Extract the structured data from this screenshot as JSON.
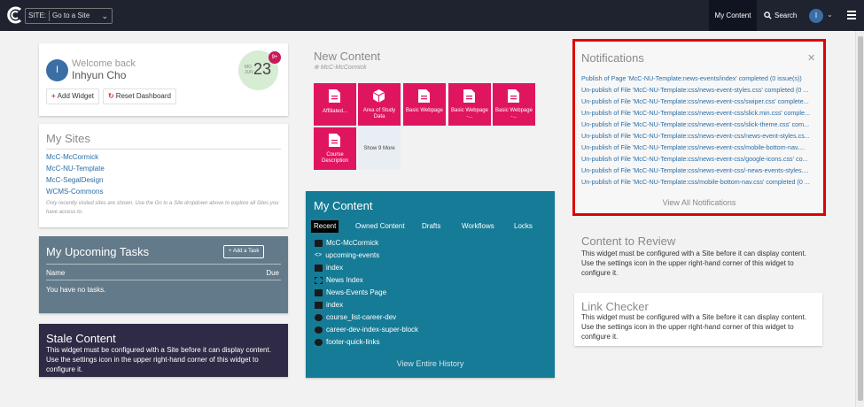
{
  "topbar": {
    "site_label": "SITE:",
    "site_select": "Go to a Site",
    "nav_my_content": "My Content",
    "nav_search": "Search",
    "user_initial": "I"
  },
  "welcome": {
    "avatar_initial": "I",
    "greeting": "Welcome back",
    "user_name": "Inhyun Cho",
    "date_month_top": "MO",
    "date_month": "JUN",
    "date_day": "23",
    "badge_count": "9+",
    "add_widget": "Add Widget",
    "reset_dashboard": "Reset Dashboard"
  },
  "my_sites": {
    "title": "My Sites",
    "sites": [
      "McC-McCormick",
      "McC-NU-Template",
      "McC-SegalDesign",
      "WCMS-Commons"
    ],
    "note": "Only recently visited sites are shown. Use the Go to a Site dropdown above to explore all Sites you have access to."
  },
  "tasks": {
    "title": "My Upcoming Tasks",
    "add_task": "Add a Task",
    "col_name": "Name",
    "col_due": "Due",
    "empty": "You have no tasks."
  },
  "stale": {
    "title": "Stale Content",
    "message": "This widget must be configured with a Site before it can display content. Use the settings icon in the upper right-hand corner of this widget to configure it."
  },
  "new_content": {
    "title": "New Content",
    "site": "McC-McCormick",
    "tiles": [
      "Affiliated...",
      "Area of Study Data",
      "Basic Webpage",
      "Basic Webpage -...",
      "Basic Webpage -...",
      "Course Description"
    ],
    "show_more": "Show 9 More"
  },
  "my_content": {
    "title": "My Content",
    "tabs": [
      "Recent",
      "Owned Content",
      "Drafts",
      "Workflows",
      "Locks"
    ],
    "items": [
      "McC-McCormick",
      "upcoming-events",
      "index",
      "News Index",
      "News-Events Page",
      "index",
      "course_list-career-dev",
      "career-dev-index-super-block",
      "footer-quick-links"
    ],
    "view_history": "View Entire History"
  },
  "notifications": {
    "title": "Notifications",
    "items": [
      "Publish of Page 'McC-NU-Template:news-events/index' completed (0 issue(s))",
      "Un-publish of File 'McC-NU-Template:css/news-event-styles.css' completed (0 ...",
      "Un-publish of File 'McC-NU-Template:css/news-event-css/swiper.css' complete...",
      "Un-publish of File 'McC-NU-Template:css/news-event-css/slick.min.css' comple...",
      "Un-publish of File 'McC-NU-Template:css/news-event-css/slick-theme.css' com...",
      "Un-publish of File 'McC-NU-Template:css/news-event-css/news-event-styles.cs...",
      "Un-publish of File 'McC-NU-Template:css/news-event-css/mobile-bottom-nav....",
      "Un-publish of File 'McC-NU-Template:css/news-event-css/google-icons.css' co...",
      "Un-publish of File 'McC-NU-Template:css/news-event-css/-news-events-styles....",
      "Un-publish of File 'McC-NU-Template:css/mobile-bottom-nav.css' completed (0 ..."
    ],
    "view_all": "View All Notifications"
  },
  "content_review": {
    "title": "Content to Review",
    "message": "This widget must be configured with a Site before it can display content. Use the settings icon in the upper right-hand corner of this widget to configure it."
  },
  "link_checker": {
    "title": "Link Checker",
    "message": "This widget must be configured with a Site before it can display content. Use the settings icon in the upper right-hand corner of this widget to configure it."
  },
  "colors": {
    "topbar": "#1f2330",
    "tile_accent": "#e0155f",
    "my_content_bg": "#167b96",
    "tasks_bg": "#637a8a",
    "stale_bg": "#2f2a45",
    "highlight_border": "#e00000"
  }
}
